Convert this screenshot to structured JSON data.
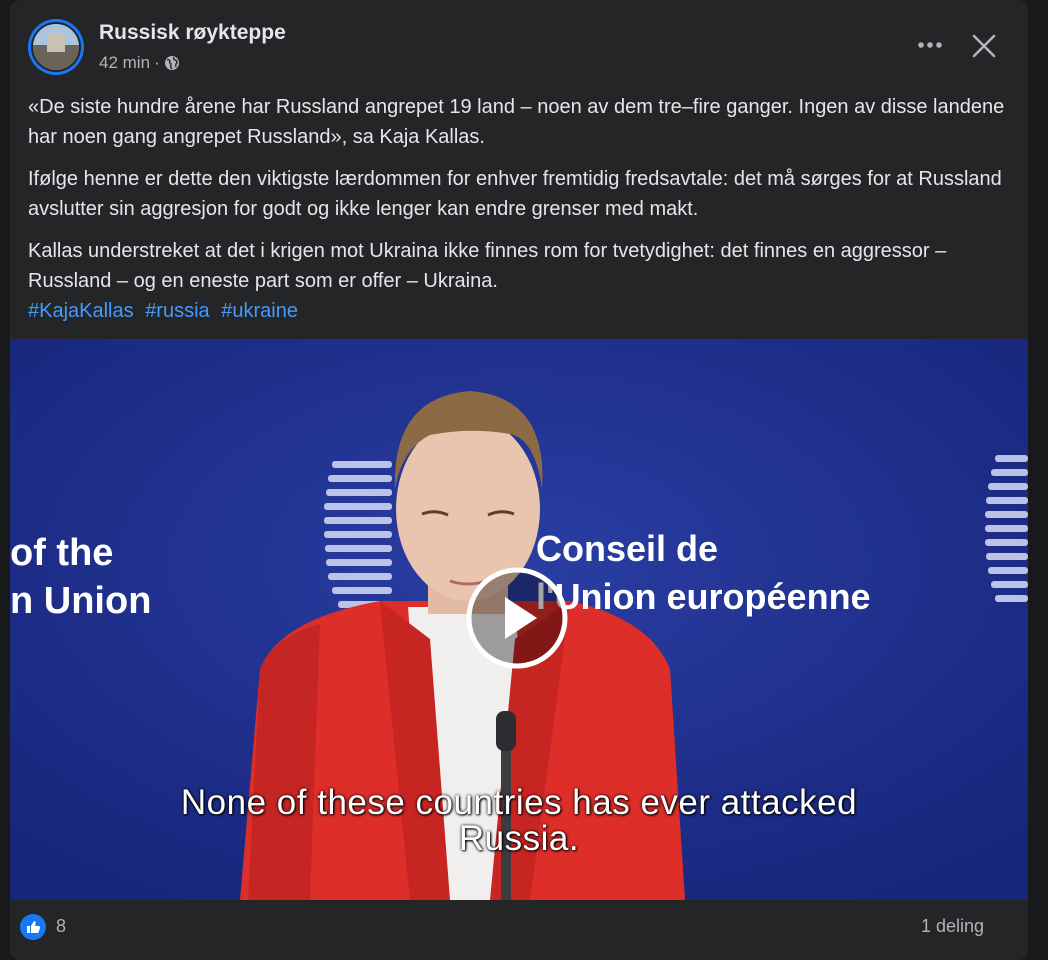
{
  "post": {
    "page_name": "Russisk røykteppe",
    "time": "42 min",
    "separator": "·",
    "privacy_icon": "globe-icon",
    "header_actions": [
      "more-options-icon",
      "close-icon"
    ],
    "paragraphs": [
      "«De siste hundre årene har Russland angrepet 19 land – noen av dem tre–fire ganger. Ingen av disse landene har noen gang angrepet Russland», sa Kaja Kallas.",
      "Ifølge henne er dette den viktigste lærdommen for enhver fremtidig fredsavtale: det må sørges for at Russland avslutter sin aggresjon for godt og ikke lenger kan endre grenser med makt.",
      "Kallas understreket at det i krigen mot Ukraina ikke finnes rom for tvetydighet: det finnes en aggressor – Russland – og en eneste part som er offer – Ukraina."
    ],
    "hashtags": [
      "#KajaKallas",
      "#russia",
      "#ukraine"
    ]
  },
  "video": {
    "backdrop_left_line1": "of the",
    "backdrop_left_line2": "n Union",
    "backdrop_center_line1": "Conseil de",
    "backdrop_center_line2": "l'Union européenne",
    "caption_line1": "None of these countries has ever attacked",
    "caption_line2": "Russia.",
    "play_icon": "play-icon"
  },
  "footer": {
    "reaction_icon": "like-icon",
    "reaction_count": "8",
    "shares": "1 deling"
  },
  "colors": {
    "card_bg": "#242526",
    "text": "#e4e6eb",
    "secondary_text": "#b0b3b8",
    "hashtag": "#4599ff",
    "video_bg": "#1f2f8c",
    "jacket": "#e0302c",
    "like_blue": "#1877f2"
  }
}
